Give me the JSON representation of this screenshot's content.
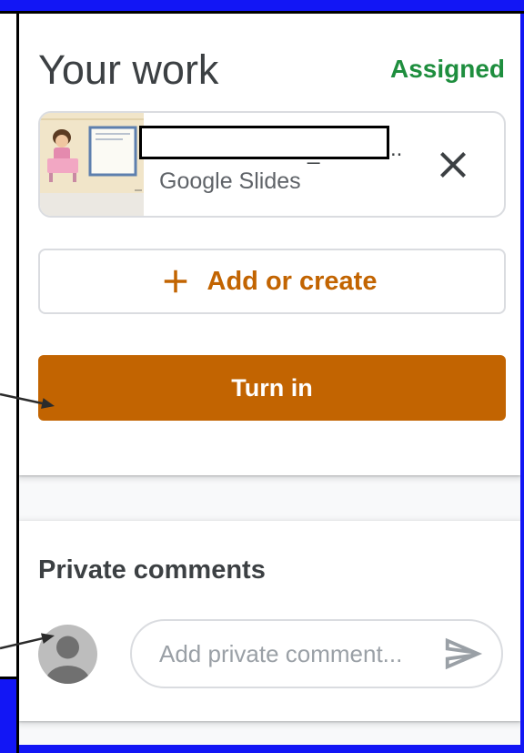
{
  "header": {
    "title": "Your work",
    "status": "Assigned"
  },
  "attachment": {
    "title_fragments": [
      "_",
      ".."
    ],
    "type_label": "Google Slides",
    "thumbnail_icon": "slide-thumbnail",
    "remove_icon": "close-icon"
  },
  "actions": {
    "add_icon": "plus-icon",
    "add_label": "Add or create",
    "turn_in_label": "Turn in"
  },
  "private_comments": {
    "heading": "Private comments",
    "avatar_icon": "person-icon",
    "placeholder": "Add private comment...",
    "send_icon": "send-icon"
  },
  "annotations": {
    "arrow_icon": "arrow-right-icon"
  },
  "colors": {
    "accent": "#c26401",
    "status_green": "#1e8e3e",
    "frame_blue": "#1216f5",
    "text_primary": "#3c4043",
    "text_secondary": "#5f6368",
    "placeholder": "#9aa0a6",
    "border": "#dadce0"
  }
}
